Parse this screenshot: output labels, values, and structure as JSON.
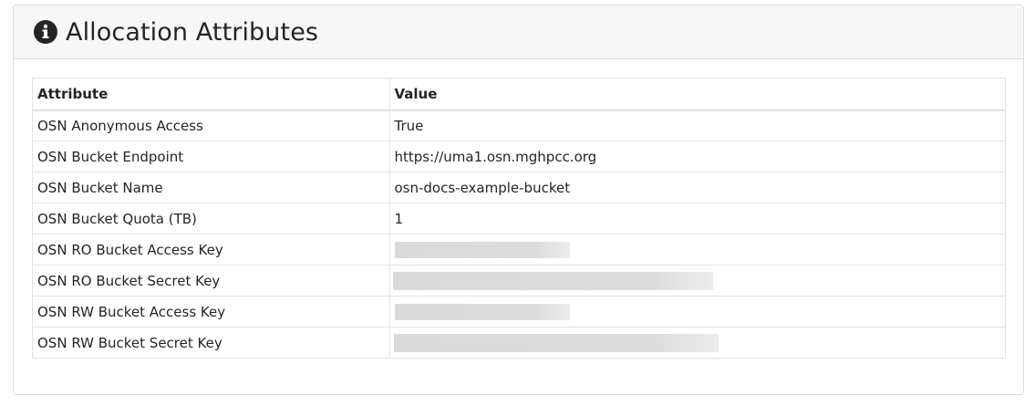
{
  "card": {
    "title": "Allocation Attributes",
    "icon": "info-circle-icon"
  },
  "table": {
    "headers": [
      "Attribute",
      "Value"
    ],
    "rows": [
      {
        "attribute": "OSN Anonymous Access",
        "value": "True",
        "redacted": false
      },
      {
        "attribute": "OSN Bucket Endpoint",
        "value": "https://uma1.osn.mghpcc.org",
        "redacted": false
      },
      {
        "attribute": "OSN Bucket Name",
        "value": "osn-docs-example-bucket",
        "redacted": false
      },
      {
        "attribute": "OSN Bucket Quota (TB)",
        "value": "1",
        "redacted": false
      },
      {
        "attribute": "OSN RO Bucket Access Key",
        "value": "",
        "redacted": true
      },
      {
        "attribute": "OSN RO Bucket Secret Key",
        "value": "",
        "redacted": true
      },
      {
        "attribute": "OSN RW Bucket Access Key",
        "value": "",
        "redacted": true
      },
      {
        "attribute": "OSN RW Bucket Secret Key",
        "value": "",
        "redacted": true
      }
    ]
  },
  "colors": {
    "header_bg": "#f7f7f7",
    "border": "#dee2e6",
    "text": "#212529",
    "redaction": "#d9d9d9"
  }
}
